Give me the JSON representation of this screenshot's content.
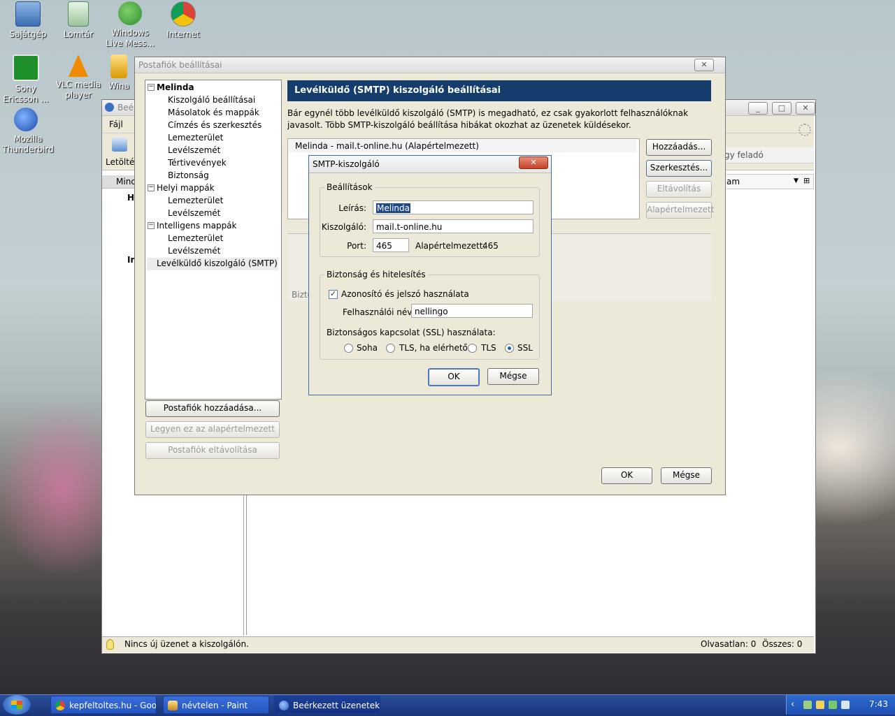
{
  "desktop": {
    "icons": [
      {
        "label": "Sajátgép"
      },
      {
        "label": "Lomtár"
      },
      {
        "label": "Windows Live Mess..."
      },
      {
        "label": "Internet"
      },
      {
        "label": "Sony Ericsson ..."
      },
      {
        "label": "VLC media player"
      },
      {
        "label": "Wina"
      },
      {
        "label": "Mozilla Thunderbird"
      }
    ]
  },
  "thunderbird_bg": {
    "title": "Beér",
    "menu_file": "Fájl",
    "toolbar_download": "Letöltés",
    "folder_header": "Minc",
    "folder_h": "H",
    "folder_in": "In",
    "col_sender": "gy feladó",
    "col_am": "am",
    "status_text": "Nincs új üzenet a kiszolgálón.",
    "unread": "Olvasatlan: 0",
    "total": "Összes: 0"
  },
  "account_settings": {
    "title": "Postafiók beállításai",
    "tree": {
      "account": "Melinda",
      "account_items": [
        "Kiszolgáló beállításai",
        "Másolatok és mappák",
        "Címzés és szerkesztés",
        "Lemezterület",
        "Levélszemét",
        "Tértivevények",
        "Biztonság"
      ],
      "local": "Helyi mappák",
      "local_items": [
        "Lemezterület",
        "Levélszemét"
      ],
      "smart": "Intelligens mappák",
      "smart_items": [
        "Lemezterület",
        "Levélszemét"
      ],
      "smtp": "Levélküldő kiszolgáló (SMTP)"
    },
    "buttons": {
      "add_account": "Postafiók hozzáadása...",
      "set_default": "Legyen ez az alapértelmezett",
      "remove_account": "Postafiók eltávolítása",
      "ok": "OK",
      "cancel": "Mégse"
    },
    "panel": {
      "header": "Levélküldő (SMTP) kiszolgáló beállításai",
      "description": "Bár egynél több levélküldő kiszolgáló (SMTP) is megadható, ez csak gyakorlott felhasználóknak javasolt. Több SMTP-kiszolgáló beállítása hibákat okozhat az üzenetek küldésekor.",
      "server_entry": "Melinda - mail.t-online.hu (Alapértelmezett)",
      "add": "Hozzáadás...",
      "edit": "Szerkesztés...",
      "remove": "Eltávolítás",
      "default": "Alapértelmezett",
      "details_label": "Bizto"
    }
  },
  "smtp_dialog": {
    "title": "SMTP-kiszolgáló",
    "settings_legend": "Beállítások",
    "desc_label": "Leírás:",
    "desc_value": "Melinda",
    "server_label": "Kiszolgáló:",
    "server_value": "mail.t-online.hu",
    "port_label": "Port:",
    "port_value": "465",
    "default_label": "Alapértelmezett:",
    "default_value": "465",
    "security_legend": "Biztonság és hitelesítés",
    "use_auth": "Azonosító és jelszó használata",
    "username_label": "Felhasználói név:",
    "username_value": "nellingo",
    "ssl_label": "Biztonságos kapcsolat (SSL) használata:",
    "radio_options": [
      "Soha",
      "TLS, ha elérhető",
      "TLS",
      "SSL"
    ],
    "selected": "SSL",
    "ok": "OK",
    "cancel": "Mégse"
  },
  "taskbar": {
    "items": [
      "kepfeltoltes.hu - Goo...",
      "névtelen - Paint",
      "Beérkezett üzenetek ..."
    ],
    "clock": "7:43"
  }
}
